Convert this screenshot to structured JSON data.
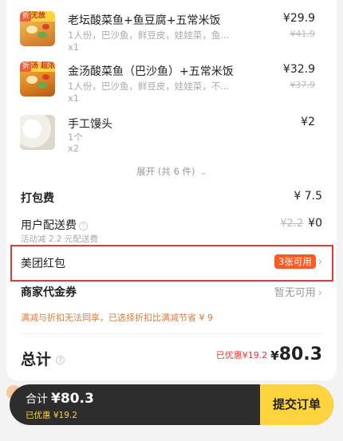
{
  "items": [
    {
      "thumb_tag": "折",
      "thumb_strip": "无放",
      "name": "老坛酸菜鱼+鱼豆腐+五常米饭",
      "desc": "1人份，巴沙鱼，鲜豆皮，娃娃菜，鱼...",
      "qty": "x1",
      "price": "¥29.9",
      "orig_price": "¥41.9"
    },
    {
      "thumb_tag": "折",
      "thumb_strip": "汤 超浓",
      "name": "金汤酸菜鱼（巴沙鱼）+五常米饭",
      "desc": "1人份，巴沙鱼，鲜豆皮，娃娃菜，不...",
      "qty": "x1",
      "price": "¥32.9",
      "orig_price": "¥37.9"
    },
    {
      "name": "手工馒头",
      "desc": "1个",
      "qty": "x2",
      "price": "¥2"
    }
  ],
  "expand_label": "展开 (共 6 件)",
  "packing": {
    "label": "打包费",
    "value": "¥ 7.5"
  },
  "delivery": {
    "label": "用户配送费",
    "orig": "¥2.2",
    "value": "¥0",
    "note": "活动减 2.2 元配送费"
  },
  "redpacket": {
    "label": "美团红包",
    "badge": "3张可用"
  },
  "voucher": {
    "label": "商家代金券",
    "value": "暂无可用"
  },
  "discount_note": "满减与折扣无法同享，已选择折扣比满减节省 ¥ 9",
  "total": {
    "label": "总计",
    "discount": "已优惠¥19.2",
    "currency": "¥",
    "amount": "80.3"
  },
  "bottom_bar": {
    "sum_label": "合计",
    "sum_value": "¥80.3",
    "saved": "已优惠 ¥19.2",
    "submit": "提交订单"
  },
  "colors": {
    "accent_yellow": "#ffd33d",
    "alert_red": "#e53935",
    "pill_orange": "#ff5a26",
    "bar_dark": "#2d2d2d"
  }
}
